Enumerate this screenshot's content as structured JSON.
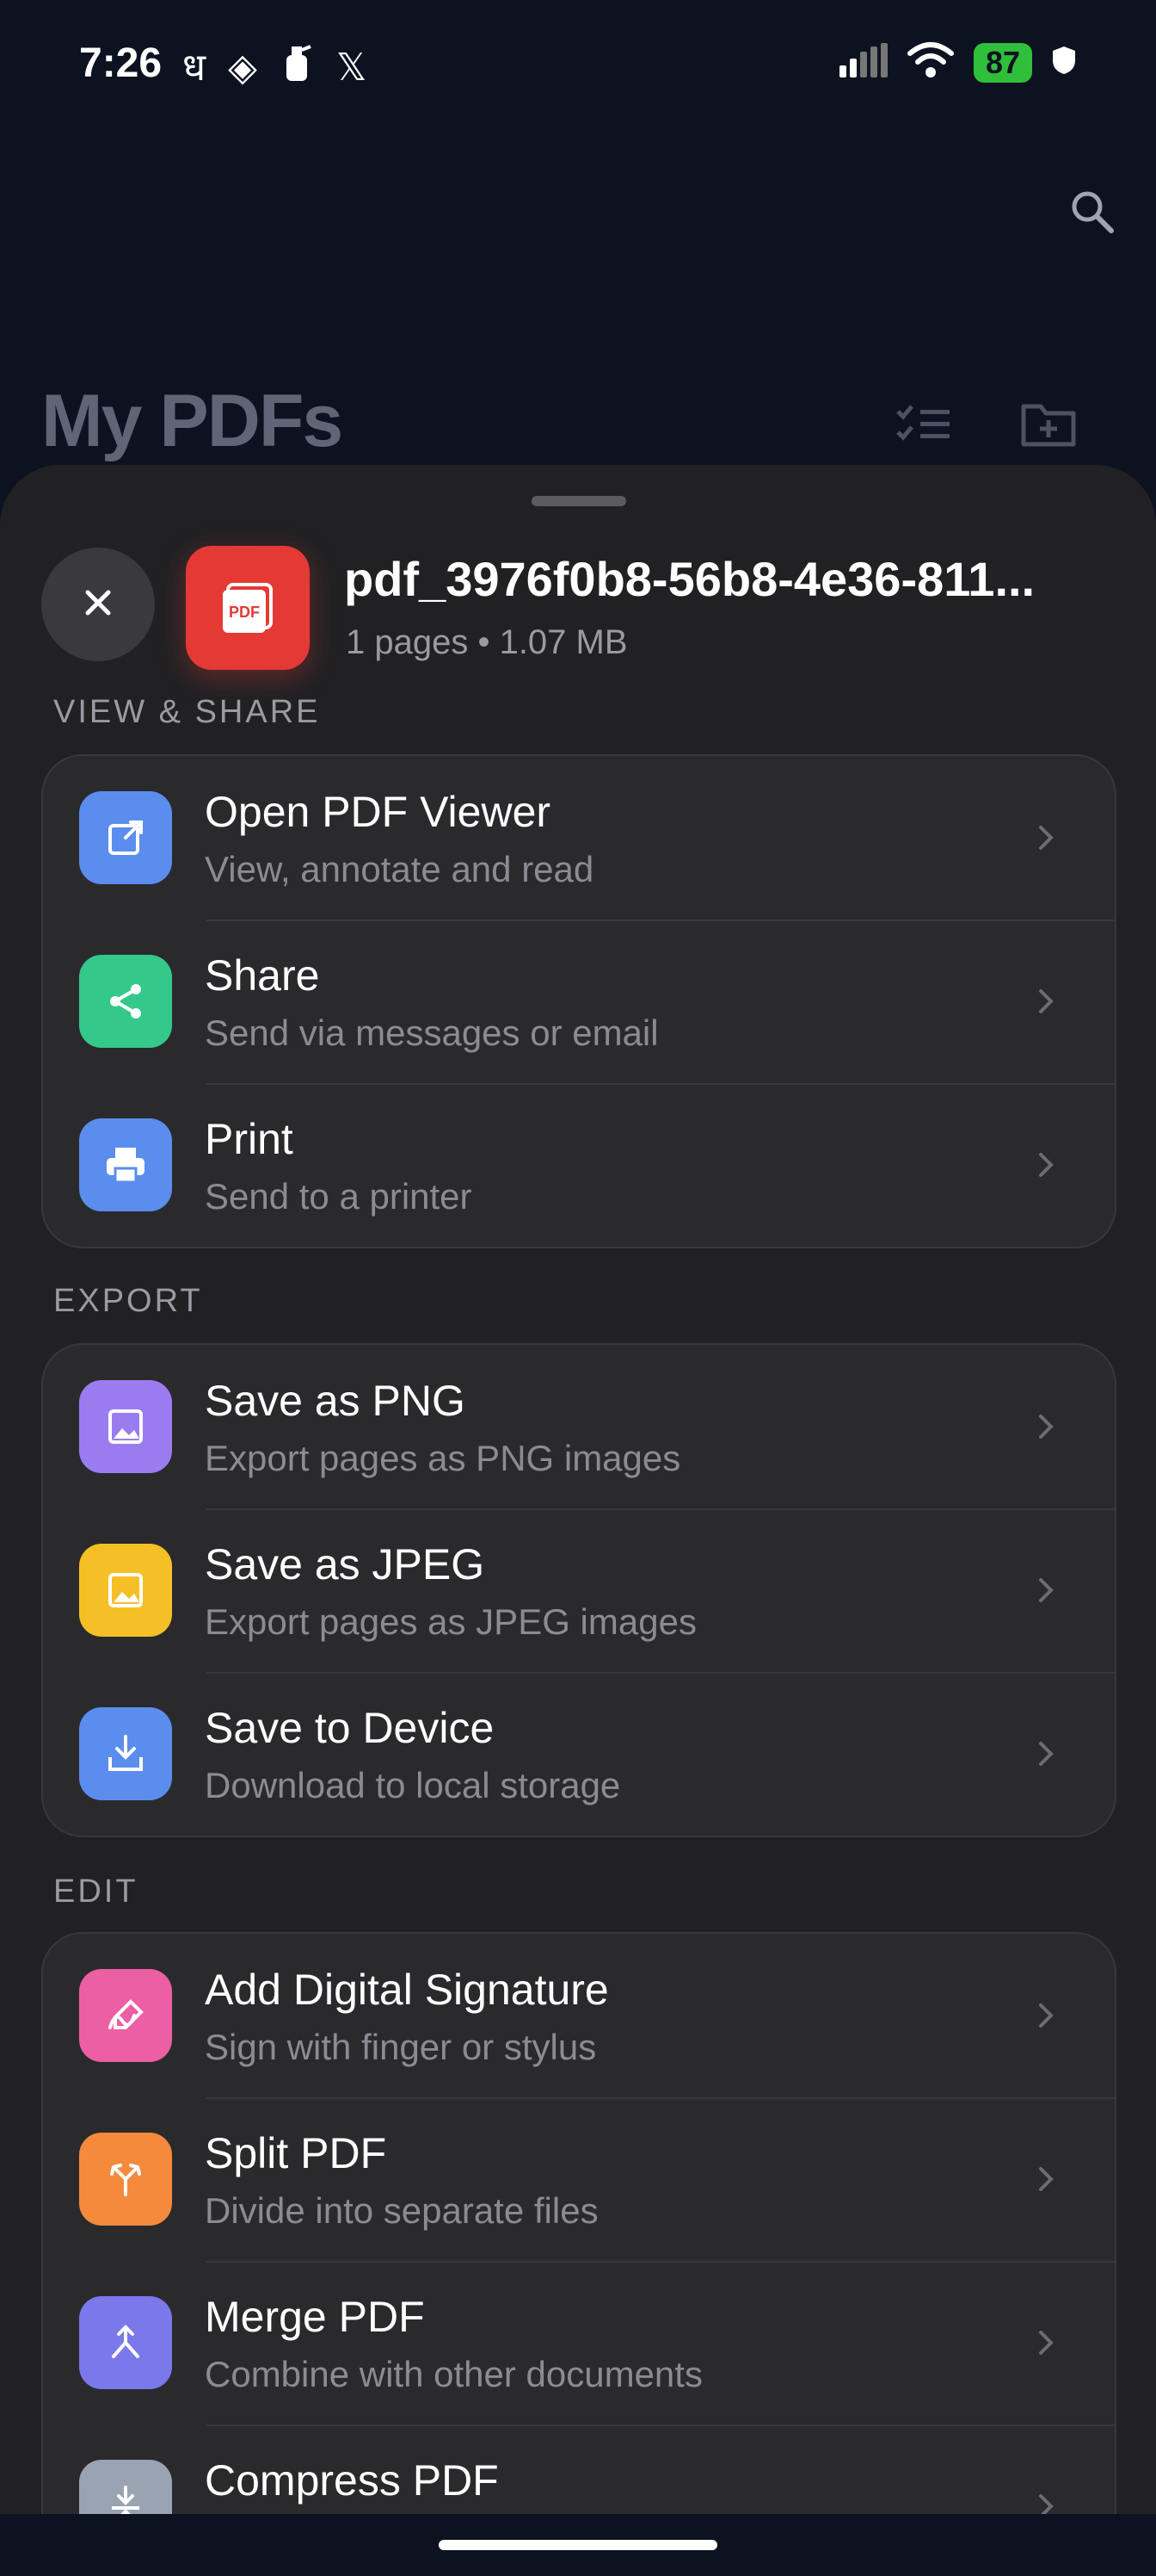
{
  "status_bar": {
    "time": "7:26",
    "left_icons": [
      "ध",
      "◈",
      "🧯",
      "𝕏"
    ],
    "battery": "87"
  },
  "header": {
    "title": "My PDFs",
    "search_icon": "search-icon",
    "select_icon": "checklist-icon",
    "new_folder_icon": "folder-plus-icon"
  },
  "sheet": {
    "close_label": "×",
    "file_badge": "PDF",
    "file_name": "pdf_3976f0b8-56b8-4e36-811...",
    "file_meta": "1 pages • 1.07 MB",
    "sections": [
      {
        "label": "VIEW & SHARE",
        "items": [
          {
            "title": "Open PDF Viewer",
            "subtitle": "View, annotate and read",
            "icon": "open-external-icon",
            "color": "#5b8def"
          },
          {
            "title": "Share",
            "subtitle": "Send via messages or email",
            "icon": "share-icon",
            "color": "#34c98a"
          },
          {
            "title": "Print",
            "subtitle": "Send to a printer",
            "icon": "printer-icon",
            "color": "#5b8def"
          }
        ]
      },
      {
        "label": "EXPORT",
        "items": [
          {
            "title": "Save as PNG",
            "subtitle": "Export pages as PNG images",
            "icon": "image-icon",
            "color": "#9b7cf0"
          },
          {
            "title": "Save as JPEG",
            "subtitle": "Export pages as JPEG images",
            "icon": "image-icon",
            "color": "#f5c026"
          },
          {
            "title": "Save to Device",
            "subtitle": "Download to local storage",
            "icon": "download-icon",
            "color": "#5b8def"
          }
        ]
      },
      {
        "label": "EDIT",
        "items": [
          {
            "title": "Add Digital Signature",
            "subtitle": "Sign with finger or stylus",
            "icon": "signature-icon",
            "color": "#ec5fa4"
          },
          {
            "title": "Split PDF",
            "subtitle": "Divide into separate files",
            "icon": "split-icon",
            "color": "#f58a3d"
          },
          {
            "title": "Merge PDF",
            "subtitle": "Combine with other documents",
            "icon": "merge-icon",
            "color": "#7b78ec"
          },
          {
            "title": "Compress PDF",
            "subtitle": "",
            "icon": "compress-icon",
            "color": "#9aa3b2"
          }
        ]
      }
    ]
  }
}
